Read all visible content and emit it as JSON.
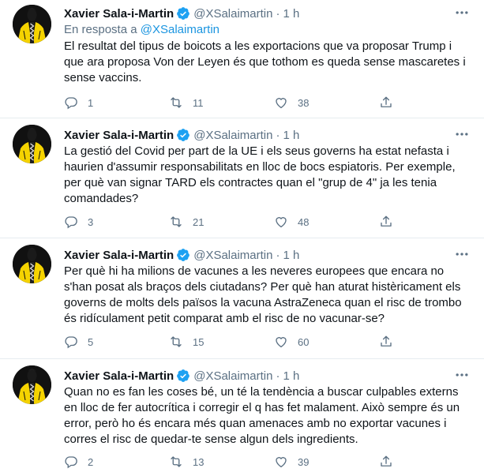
{
  "tweets": [
    {
      "author": "Xavier Sala-i-Martin",
      "handle": "@XSalaimartin",
      "separator": "·",
      "time": "1 h",
      "reply_prefix": "En resposta a",
      "reply_handle": "@XSalaimartin",
      "text": "El resultat del tipus de boicots a les exportacions que va proposar Trump i que ara proposa Von der Leyen és que tothom es queda sense mascaretes i sense vaccins.",
      "replies": "1",
      "retweets": "11",
      "likes": "38"
    },
    {
      "author": "Xavier Sala-i-Martin",
      "handle": "@XSalaimartin",
      "separator": "·",
      "time": "1 h",
      "text": "La gestió del Covid per part de la UE i els seus governs ha estat nefasta i haurien d'assumir responsabilitats en lloc de bocs espiatoris. Per exemple, per què van signar TARD els contractes quan el \"grup de 4\" ja les tenia comandades?",
      "replies": "3",
      "retweets": "21",
      "likes": "48"
    },
    {
      "author": "Xavier Sala-i-Martin",
      "handle": "@XSalaimartin",
      "separator": "·",
      "time": "1 h",
      "text": "Per què hi ha milions de vacunes a les neveres europees que encara no s'han posat als braços dels ciutadans? Per què han aturat histèricament els governs de molts dels països la vacuna AstraZeneca quan el risc de trombo és ridículament petit comparat amb el risc de no vacunar-se?",
      "replies": "5",
      "retweets": "15",
      "likes": "60"
    },
    {
      "author": "Xavier Sala-i-Martin",
      "handle": "@XSalaimartin",
      "separator": "·",
      "time": "1 h",
      "text": "Quan no es fan les coses bé, un té la tendència a buscar culpables externs en lloc de fer autocrítica i corregir el q has fet malament. Això sempre és un error, però ho és encara més quan amenaces amb no exportar vacunes i corres el risc de quedar-te sense algun dels ingredients.",
      "replies": "2",
      "retweets": "13",
      "likes": "39"
    }
  ],
  "icons": {
    "verified": "verified-badge-icon",
    "more": "more-options-icon",
    "reply": "reply-icon",
    "retweet": "retweet-icon",
    "like": "like-icon",
    "share": "share-icon"
  },
  "colors": {
    "text": "#0f1419",
    "secondary": "#5b7083",
    "link": "#1b95e0",
    "verified": "#1da1f2",
    "divider": "#e6ecf0",
    "avatar_accent": "#f5d300"
  }
}
